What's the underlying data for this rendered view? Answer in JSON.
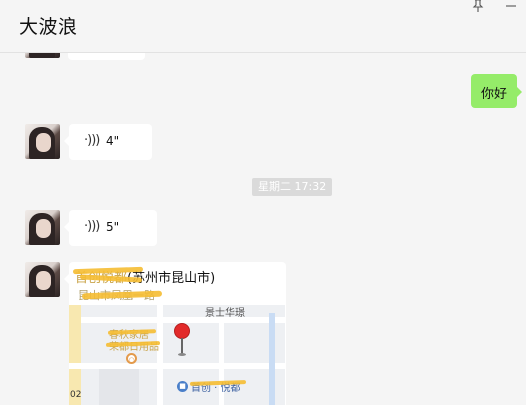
{
  "header": {
    "title": "大波浪",
    "pin_icon": "pin-icon",
    "minimize_icon": "minimize-icon"
  },
  "messages": {
    "sent_text": "你好",
    "voice_1": "4\"",
    "voice_2": "5\"",
    "timestamp": "星期二 17:32",
    "location_title_suffix": "(苏州市昆山市)",
    "location_title_obscured": "首创悦都",
    "location_address_obscured": "昆山市凤凰一路"
  },
  "map": {
    "label_top": "景士华璟",
    "label_left_1": "春秋家居",
    "label_left_2": "荣都日用品",
    "label_bottom": "首创 · 悦都",
    "scale": "02"
  },
  "colors": {
    "sent_bubble": "#95ec69",
    "pin": "#e22a2a",
    "scribble": "#f5bd32"
  }
}
